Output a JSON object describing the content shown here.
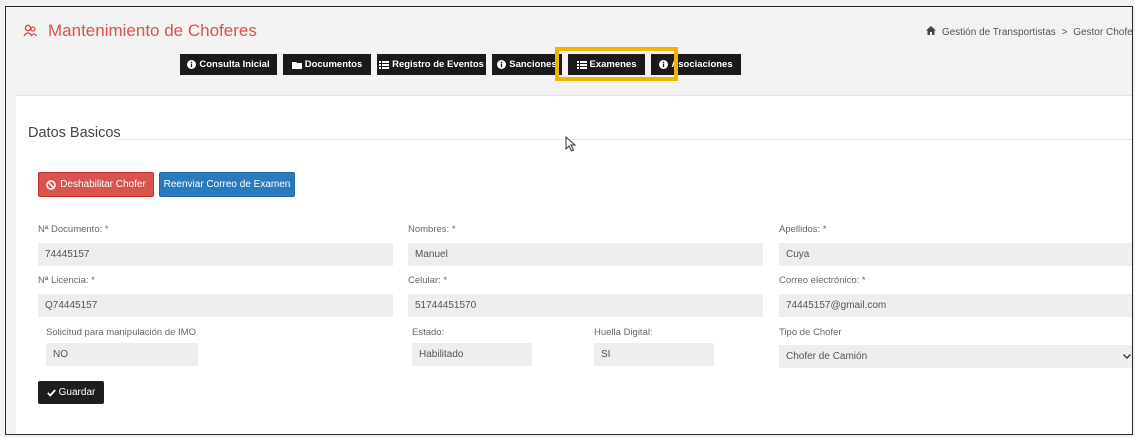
{
  "header": {
    "title": "Mantenimiento de Choferes",
    "title_icon": "user-group-icon",
    "breadcrumb": {
      "home": "Gestión de Transportistas",
      "separator": ">",
      "current": "Gestor Chofer"
    }
  },
  "tabs": [
    {
      "label": "Consulta Inicial",
      "icon": "info-circle-icon"
    },
    {
      "label": "Documentos",
      "icon": "folder-icon"
    },
    {
      "label": "Registro de Eventos",
      "icon": "list-icon"
    },
    {
      "label": "Sanciones",
      "icon": "info-circle-icon"
    },
    {
      "label": "Examenes",
      "icon": "list-icon"
    },
    {
      "label": "Asociaciones",
      "icon": "info-circle-icon"
    }
  ],
  "section": {
    "title": "Datos Basicos"
  },
  "actions": {
    "disable": "Deshabilitar Chofer",
    "resend": "Reenviar Correo de Examen",
    "save": "Guardar"
  },
  "form": {
    "documento": {
      "label": "Nª Documento: *",
      "value": "74445157"
    },
    "nombres": {
      "label": "Nombres: *",
      "value": "Manuel"
    },
    "apellidos": {
      "label": "Apellidos: *",
      "value": "Cuya"
    },
    "licencia": {
      "label": "Nª Licencia: *",
      "value": "Q74445157"
    },
    "celular": {
      "label": "Celular: *",
      "value": "51744451570"
    },
    "correo": {
      "label": "Correo electrónico: *",
      "value": "74445157@gmail.com"
    },
    "imo": {
      "label": "Solicitud para manipulación de IMO",
      "value": "NO"
    },
    "estado": {
      "label": "Estado:",
      "value": "Habilitado"
    },
    "huella": {
      "label": "Huella Digital:",
      "value": "SI"
    },
    "tipo": {
      "label": "Tipo de Chofer",
      "value": "Chofer de Camión"
    }
  },
  "colors": {
    "accent_red": "#d9534f",
    "primary_blue": "#2a7bbd",
    "tab_dark": "#1a1a1a",
    "highlight": "#f2b300"
  }
}
